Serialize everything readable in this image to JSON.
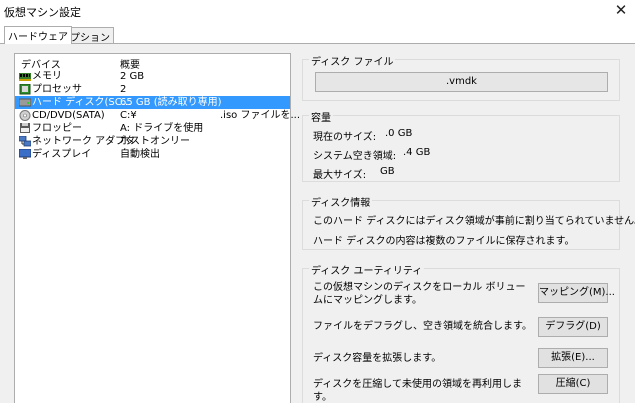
{
  "window": {
    "title": "仮想マシン設定",
    "close_glyph": "✕"
  },
  "tabs": [
    {
      "label": "ハードウェア"
    },
    {
      "label": "オプション"
    }
  ],
  "device_list": {
    "header": {
      "device": "デバイス",
      "summary": "概要"
    },
    "rows": [
      {
        "name": "メモリ",
        "summary": "2 GB",
        "icon": "memory-icon"
      },
      {
        "name": "プロセッサ",
        "summary": "2",
        "icon": "processor-icon"
      },
      {
        "name": "ハード ディスク(SC...",
        "summary": "65 GB (読み取り専用)",
        "icon": "hard-disk-icon"
      },
      {
        "name": "CD/DVD(SATA)",
        "summary": "C:¥",
        "summary2": ".iso ファイルを...",
        "icon": "cd-dvd-icon"
      },
      {
        "name": "フロッピー",
        "summary": "A: ドライブを使用",
        "icon": "floppy-icon"
      },
      {
        "name": "ネットワーク アダプタ",
        "summary": "ホストオンリー",
        "icon": "network-adapter-icon"
      },
      {
        "name": "ディスプレイ",
        "summary": "自動検出",
        "icon": "display-icon"
      }
    ]
  },
  "disk_file": {
    "label": "ディスク ファイル",
    "value": ".vmdk"
  },
  "capacity": {
    "label": "容量",
    "current_label": "現在のサイズ:",
    "current_value": ".0 GB",
    "free_label": "システム空き領域:",
    "free_value": ".4 GB",
    "max_label": "最大サイズ:",
    "max_value": "GB"
  },
  "disk_info": {
    "label": "ディスク情報",
    "line1": "このハード ディスクにはディスク領域が事前に割り当てられていません。",
    "line2": "ハード ディスクの内容は複数のファイルに保存されます。"
  },
  "utilities": {
    "label": "ディスク ユーティリティ",
    "map_text": "この仮想マシンのディスクをローカル ボリュームにマッピングします。",
    "map_button": "マッピング(M)...",
    "defrag_text": "ファイルをデフラグし、空き領域を統合します。",
    "defrag_button": "デフラグ(D)",
    "expand_text": "ディスク容量を拡張します。",
    "expand_button": "拡張(E)...",
    "compact_text": "ディスクを圧縮して未使用の領域を再利用します。",
    "compact_button": "圧縮(C)"
  },
  "colors": {
    "selection": "#3399ff",
    "panel_bg": "#f0f0f0"
  }
}
